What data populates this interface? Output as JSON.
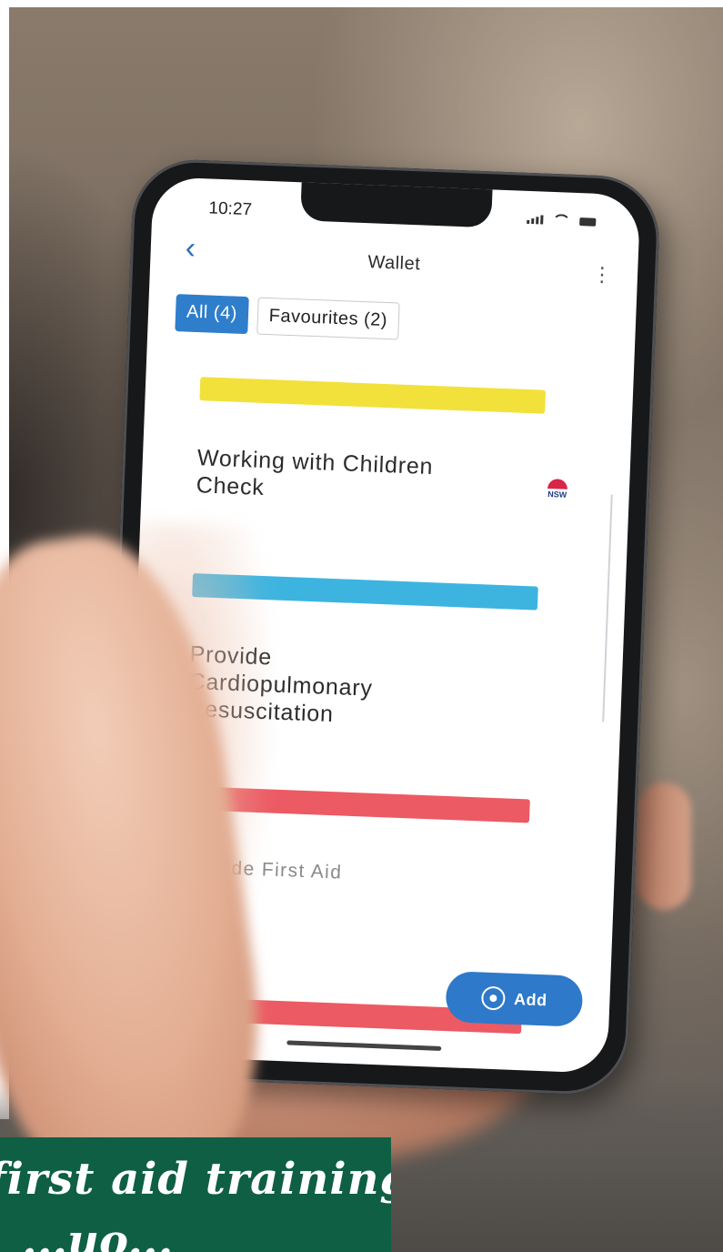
{
  "status_bar": {
    "time": "10:27"
  },
  "header": {
    "back_icon": "chevron-left-icon",
    "title": "Wallet",
    "menu_icon": "more-vertical-icon"
  },
  "filters": [
    {
      "label": "All (4)",
      "active": true
    },
    {
      "label": "Favourites (2)",
      "active": false
    }
  ],
  "cards": [
    {
      "title": "Working with Children Check",
      "band_color": "#f2e13a",
      "badge": "NSW"
    },
    {
      "title": "Provide Cardiopulmonary Resuscitation",
      "band_color": "#3db4e0"
    },
    {
      "title": "Provide First Aid",
      "band_color": "#ec5a63"
    },
    {
      "title": "",
      "band_color": "#ec5a63"
    }
  ],
  "add_button": {
    "label": "Add",
    "icon": "add-circle-icon"
  },
  "banner": {
    "text": "first aid training",
    "text_line2": "...uo..."
  }
}
